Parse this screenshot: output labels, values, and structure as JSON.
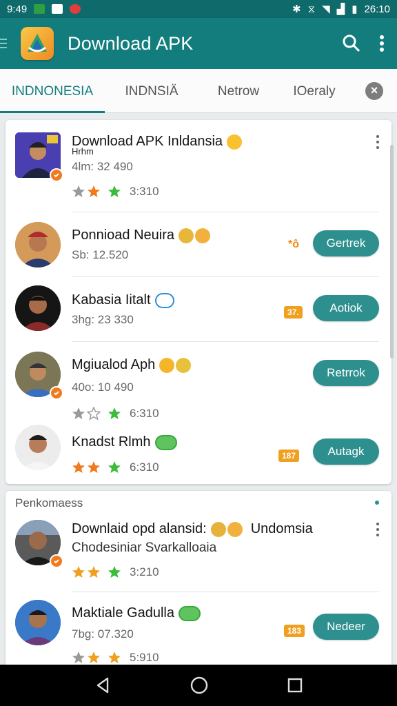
{
  "status": {
    "time_left": "9:49",
    "time_right": "26:10"
  },
  "appbar": {
    "title": "Download APK"
  },
  "tabs": [
    {
      "label": "INDNONESIA",
      "active": true
    },
    {
      "label": "INDNSIÄ",
      "active": false
    },
    {
      "label": "Netrow",
      "active": false
    },
    {
      "label": "IOeraly",
      "active": false
    }
  ],
  "card1": {
    "items": [
      {
        "name": "Download APK Inldansia",
        "name2": "Hrhm",
        "sub": "4lm: 32 490",
        "rating": "3:310",
        "button": ""
      },
      {
        "name": "Ponnioad Neuira",
        "sub": "Sb: 12.520",
        "rating": "",
        "tag": "*ô",
        "button": "Gertrek"
      },
      {
        "name": "Kabasia Iitalt",
        "sub": "3hg: 23 330",
        "rating": "",
        "tag": "37.",
        "button": "Aotiok"
      },
      {
        "name": "Mgiualod Aph",
        "sub": "40o: 10 490",
        "rating": "6:310",
        "button": "Retrrok"
      },
      {
        "name": "Knadst Rlmh",
        "sub": "",
        "rating": "6:310",
        "tag": "187",
        "button": "Autagk"
      }
    ]
  },
  "card2": {
    "section": "Penkomaess",
    "items": [
      {
        "name": "Downlaid opd alansid:",
        "name_suffix": "Undomsia",
        "sub": "Chodesiniar Svarkalloaia",
        "rating": "3:210"
      },
      {
        "name": "Maktiale Gadulla",
        "sub": "7bg: 07.320",
        "rating": "5:910",
        "tag": "183",
        "button": "Nedeer"
      }
    ]
  },
  "colors": {
    "primary": "#137d7d",
    "button": "#2e8f8f",
    "star_orange": "#f07a1c",
    "star_green": "#3cbb3c"
  }
}
